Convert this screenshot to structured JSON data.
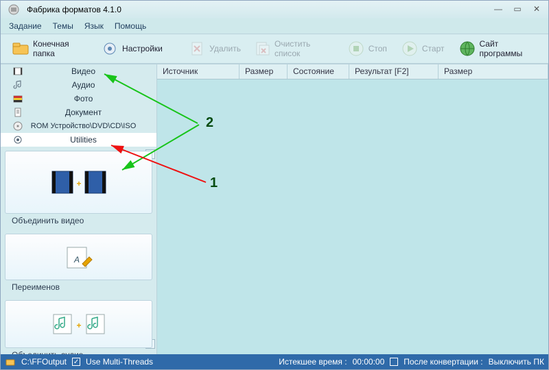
{
  "window": {
    "title": "Фабрика форматов 4.1.0"
  },
  "menu": {
    "items": [
      "Задание",
      "Темы",
      "Язык",
      "Помощь"
    ]
  },
  "toolbar": {
    "outputFolder": "Конечная папка",
    "settings": "Настройки",
    "delete": "Удалить",
    "clearList": "Очистить список",
    "stop": "Стоп",
    "start": "Старт",
    "site": "Сайт программы"
  },
  "categories": [
    {
      "label": "Видео",
      "icon": "film"
    },
    {
      "label": "Аудио",
      "icon": "note"
    },
    {
      "label": "Фото",
      "icon": "photo"
    },
    {
      "label": "Документ",
      "icon": "doc"
    },
    {
      "label": "ROM Устройство\\DVD\\CD\\ISO",
      "icon": "disc"
    },
    {
      "label": "Utilities",
      "icon": "gear",
      "selected": true
    }
  ],
  "utilities": [
    {
      "label": "Объединить видео"
    },
    {
      "label": "Переименов"
    },
    {
      "label": "Объединить аудио"
    }
  ],
  "grid": {
    "columns": [
      "Источник",
      "Размер",
      "Состояние",
      "Результат [F2]",
      "Размер"
    ]
  },
  "status": {
    "path": "C:\\FFOutput",
    "multiThreads": "Use Multi-Threads",
    "multiThreadsChecked": true,
    "elapsedLabel": "Истекшее время :",
    "elapsedValue": "00:00:00",
    "afterLabel": "После конвертации :",
    "afterValue": "Выключить ПК",
    "afterChecked": false
  },
  "annotations": {
    "a1": "1",
    "a2": "2"
  }
}
